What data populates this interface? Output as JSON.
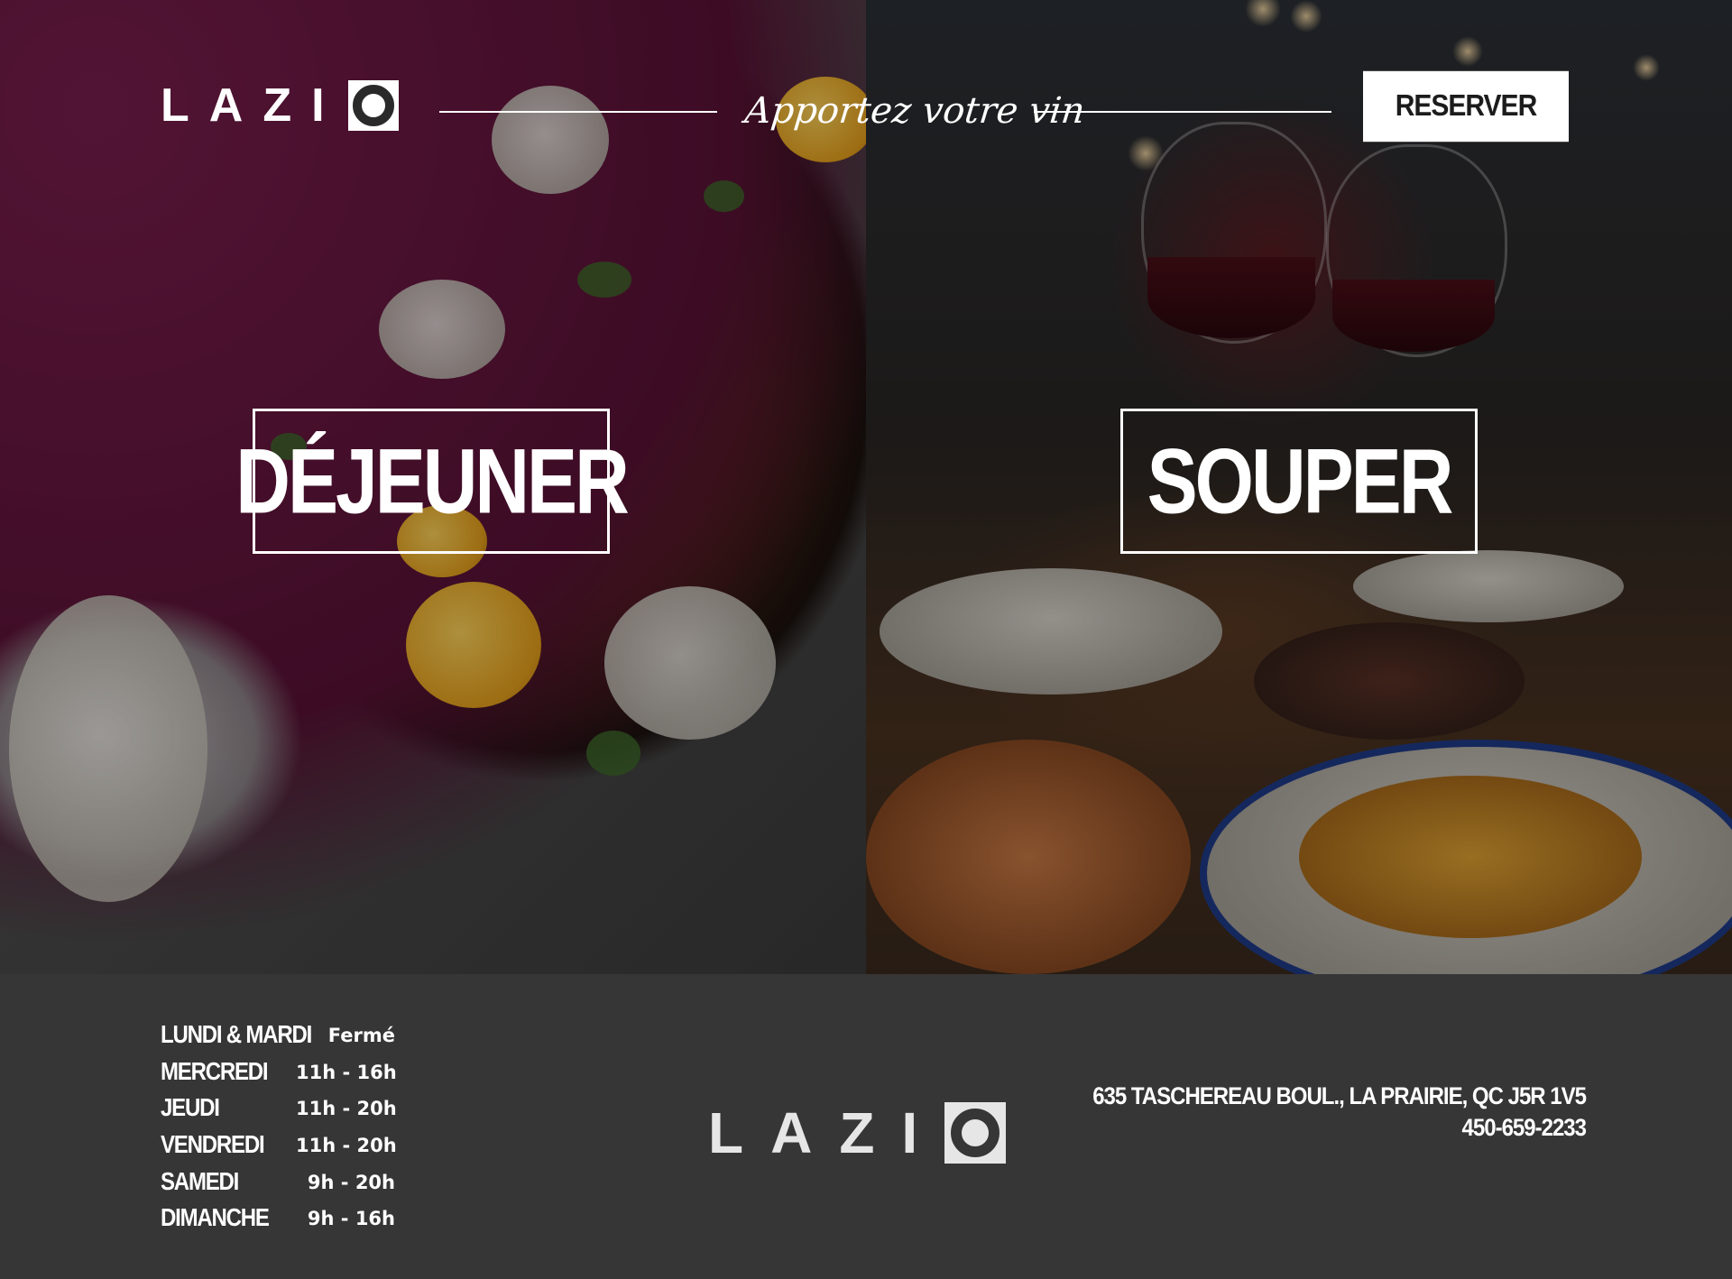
{
  "brand": {
    "name": "LAZI",
    "mark_letter": "O"
  },
  "header": {
    "tagline": "Apportez votre vin",
    "reserve_label": "RESERVER"
  },
  "hero": {
    "left_label": "DÉJEUNER",
    "right_label": "SOUPER"
  },
  "hours": [
    {
      "day": "LUNDI & MARDI",
      "time": "Fermé"
    },
    {
      "day": "MERCREDI",
      "time": "11h - 16h"
    },
    {
      "day": "JEUDI",
      "time": "11h - 20h"
    },
    {
      "day": "VENDREDI",
      "time": "11h - 20h"
    },
    {
      "day": "SAMEDI",
      "time": "9h - 20h"
    },
    {
      "day": "DIMANCHE",
      "time": "9h - 16h"
    }
  ],
  "contact": {
    "address": "635 TASCHEREAU BOUL., LA PRAIRIE, QC J5R 1V5",
    "phone": "450-659-2233"
  },
  "colors": {
    "footer_bg": "#363636",
    "text": "#ffffff",
    "button_bg": "#ffffff",
    "button_text": "#1c1c1c"
  }
}
